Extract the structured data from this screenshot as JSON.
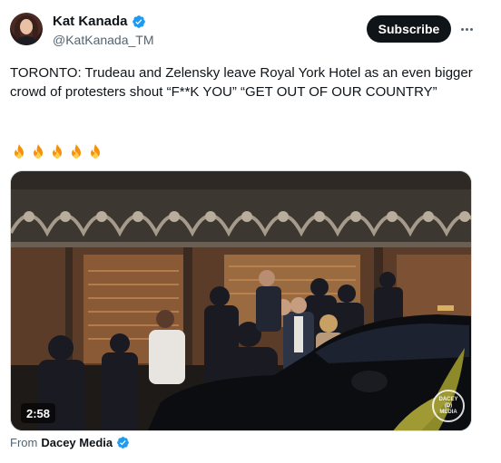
{
  "author": {
    "display_name": "Kat Kanada",
    "handle": "@KatKanada_TM",
    "verified_icon": "verified-badge-icon",
    "avatar_icon": "avatar-photo"
  },
  "actions": {
    "subscribe_label": "Subscribe",
    "more_icon": "more-options-icon"
  },
  "tweet": {
    "text": "TORONTO: Trudeau and Zelensky leave Royal York Hotel as an even bigger crowd of protesters shout “F**K YOU” “GET OUT OF OUR COUNTRY”",
    "emojis": [
      "fire",
      "fire",
      "fire",
      "fire",
      "fire"
    ]
  },
  "media": {
    "type": "video",
    "duration": "2:58",
    "watermark": "DACEY MEDIA"
  },
  "footer": {
    "from_prefix": "From",
    "source_name": "Dacey Media",
    "source_verified_icon": "verified-badge-icon"
  },
  "colors": {
    "text_primary": "#0f1419",
    "text_secondary": "#536471",
    "verified_blue": "#1d9bf0",
    "button_dark": "#0f1419",
    "fire": "#f4900c"
  }
}
